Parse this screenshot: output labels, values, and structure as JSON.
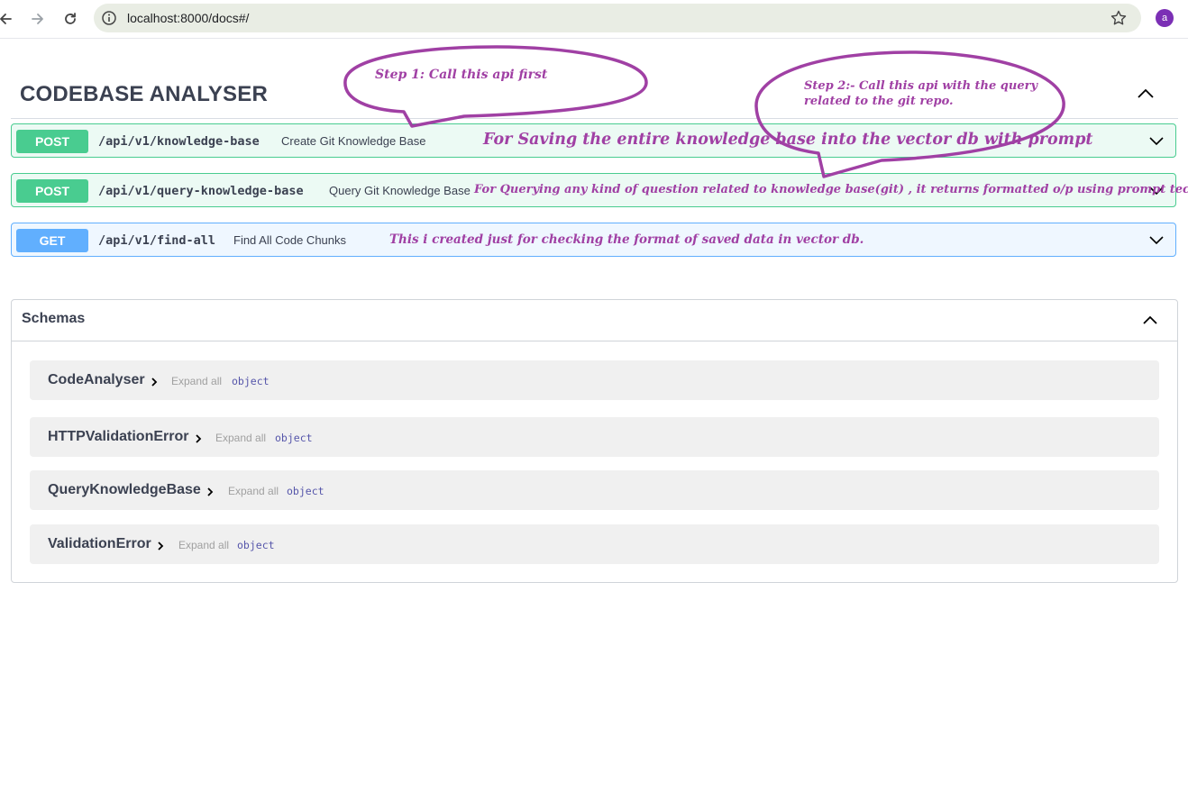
{
  "browser": {
    "url": "localhost:8000/docs#/",
    "avatar_letter": "a"
  },
  "page": {
    "title": "CODEBASE ANALYSER"
  },
  "operations": [
    {
      "method": "POST",
      "path": "/api/v1/knowledge-base",
      "summary": "Create Git Knowledge Base"
    },
    {
      "method": "POST",
      "path": "/api/v1/query-knowledge-base",
      "summary": "Query Git Knowledge Base"
    },
    {
      "method": "GET",
      "path": "/api/v1/find-all",
      "summary": "Find All Code Chunks"
    }
  ],
  "annotations": {
    "step1": "Step 1: Call this api first",
    "step2_line1": "Step 2:- Call this api with the query",
    "step2_line2": "related to the git repo.",
    "note_save": "For Saving the entire knowledge base into the vector db with prompt",
    "note_query": "For Querying any kind of question related to knowledge base(git) , it returns  formatted o/p using prompt techniques",
    "note_find": "This i created just for checking the format of saved data in vector db.",
    "color": "#a040a4"
  },
  "schemas": {
    "title": "Schemas",
    "models": [
      {
        "name": "CodeAnalyser",
        "expand_label": "Expand all",
        "type": "object"
      },
      {
        "name": "HTTPValidationError",
        "expand_label": "Expand all",
        "type": "object"
      },
      {
        "name": "QueryKnowledgeBase",
        "expand_label": "Expand all",
        "type": "object"
      },
      {
        "name": "ValidationError",
        "expand_label": "Expand all",
        "type": "object"
      }
    ]
  },
  "colors": {
    "post": "#49cc90",
    "get": "#61affe",
    "text": "#3b4151"
  }
}
